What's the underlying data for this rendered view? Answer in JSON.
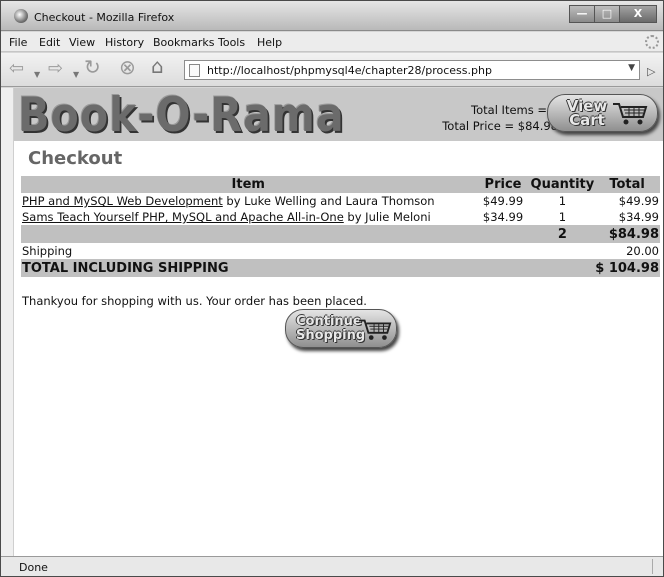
{
  "window": {
    "title": "Checkout - Mozilla Firefox",
    "controls": {
      "minimize": "—",
      "maximize": "□",
      "close": "X"
    }
  },
  "menu": [
    "File",
    "Edit",
    "View",
    "History",
    "Bookmarks",
    "Tools",
    "Help"
  ],
  "nav": {
    "url": "http://localhost/phpmysql4e/chapter28/process.php",
    "icons": [
      "back-arrow-icon",
      "forward-arrow-icon",
      "reload-icon",
      "stop-icon",
      "home-icon",
      "page-icon",
      "go-arrow-icon"
    ]
  },
  "site": {
    "logo": "Book-O-Rama",
    "total_items": "Total Items = 2",
    "total_price": "Total Price = $84.98",
    "view_cart_line1": "View",
    "view_cart_line2": "Cart"
  },
  "page": {
    "heading": "Checkout",
    "columns": {
      "item": "Item",
      "price": "Price",
      "quantity": "Quantity",
      "total": "Total"
    },
    "rows": [
      {
        "title": "PHP and MySQL Web Development",
        "author": " by Luke Welling and Laura Thomson",
        "price": "$49.99",
        "qty": "1",
        "total": "$49.99"
      },
      {
        "title": "Sams Teach Yourself PHP, MySQL and Apache All-in-One",
        "author": " by Julie Meloni",
        "price": "$34.99",
        "qty": "1",
        "total": "$34.99"
      }
    ],
    "subtotal": {
      "qty": "2",
      "total": "$84.98"
    },
    "shipping": {
      "label": "Shipping",
      "value": "20.00"
    },
    "grand": {
      "label": "TOTAL INCLUDING SHIPPING",
      "value": "$ 104.98"
    },
    "message": "Thankyou for shopping with us. Your order has been placed.",
    "continue_line1": "Continue",
    "continue_line2": "Shopping"
  },
  "status": {
    "text": "Done"
  }
}
